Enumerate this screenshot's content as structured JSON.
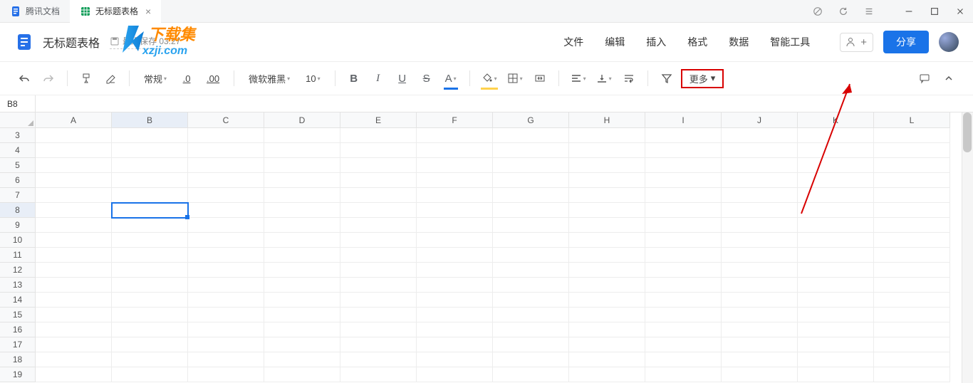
{
  "tabs": [
    {
      "label": "腾讯文档",
      "icon": "tencent-docs"
    },
    {
      "label": "无标题表格",
      "icon": "sheet",
      "close": "×"
    }
  ],
  "header": {
    "doc_title": "无标题表格",
    "save_status_prefix": "最近保存",
    "save_status_time": "03:27"
  },
  "menu": {
    "file": "文件",
    "edit": "编辑",
    "insert": "插入",
    "format": "格式",
    "data": "数据",
    "smart": "智能工具"
  },
  "share": {
    "share_label": "分享"
  },
  "toolbar": {
    "format_type": "常规",
    "decimal_decrease": ".0",
    "decimal_increase": ".00",
    "font_name": "微软雅黑",
    "font_size": "10",
    "bold": "B",
    "italic": "I",
    "underline": "U",
    "strike": "S",
    "text_color": "A",
    "more_label": "更多"
  },
  "formula_bar": {
    "name_box": "B8"
  },
  "grid": {
    "columns": [
      "A",
      "B",
      "C",
      "D",
      "E",
      "F",
      "G",
      "H",
      "I",
      "J",
      "K",
      "L"
    ],
    "rows": [
      3,
      4,
      5,
      6,
      7,
      8,
      9,
      10,
      11,
      12,
      13,
      14,
      15,
      16,
      17,
      18,
      19
    ],
    "active_col": "B",
    "active_row": 8
  },
  "watermark": {
    "text_main": "下载集",
    "text_url": "xzji.com"
  }
}
